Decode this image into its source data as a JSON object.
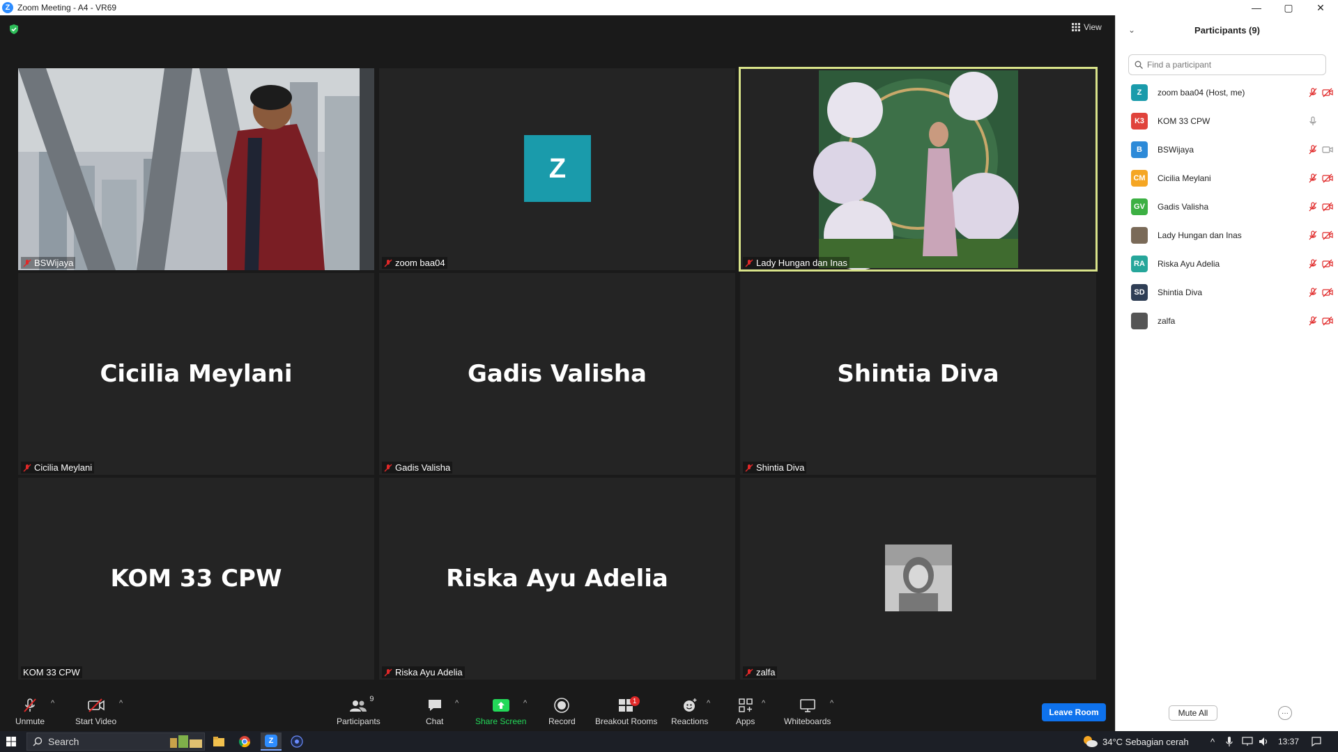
{
  "window": {
    "title": "Zoom Meeting - A4 - VR69",
    "logo_letter": "Z",
    "minimize": "—",
    "restore": "▢",
    "close": "✕"
  },
  "meeting": {
    "view_label": "View",
    "tiles": [
      {
        "name": "BSWijaya",
        "label": "BSWijaya",
        "type": "video-man",
        "muted": true
      },
      {
        "name": "zoom baa04",
        "label": "zoom baa04",
        "type": "avatar",
        "avatar_letter": "Z",
        "avatar_color": "#1a9bab",
        "muted": true
      },
      {
        "name": "Lady Hungan dan Inas",
        "label": "Lady Hungan dan Inas",
        "type": "video-woman",
        "muted": true,
        "active_speaker": true
      },
      {
        "name": "Cicilia Meylani",
        "label": "Cicilia Meylani",
        "type": "name",
        "muted": true
      },
      {
        "name": "Gadis Valisha",
        "label": "Gadis Valisha",
        "type": "name",
        "muted": true
      },
      {
        "name": "Shintia Diva",
        "label": "Shintia Diva",
        "type": "name",
        "muted": true
      },
      {
        "name": "KOM 33 CPW",
        "label": "KOM 33 CPW",
        "type": "name",
        "muted": false
      },
      {
        "name": "Riska Ayu Adelia",
        "label": "Riska Ayu Adelia",
        "type": "name",
        "muted": true
      },
      {
        "name": "zalfa",
        "label": "zalfa",
        "type": "photo",
        "muted": true
      }
    ]
  },
  "toolbar": {
    "unmute": "Unmute",
    "start_video": "Start Video",
    "participants": "Participants",
    "participants_count": "9",
    "chat": "Chat",
    "share_screen": "Share Screen",
    "record": "Record",
    "breakout_rooms": "Breakout Rooms",
    "breakout_badge": "1",
    "reactions": "Reactions",
    "apps": "Apps",
    "whiteboards": "Whiteboards",
    "leave": "Leave Room",
    "caret": "^"
  },
  "panel": {
    "title": "Participants (9)",
    "search_placeholder": "Find a participant",
    "participants": [
      {
        "initials": "Z",
        "name": "zoom baa04 (Host, me)",
        "color": "#1a9bab",
        "mic": "muted",
        "video": "off"
      },
      {
        "initials": "K3",
        "name": "KOM 33 CPW",
        "color": "#e0433b",
        "mic": "on",
        "video": "none"
      },
      {
        "initials": "B",
        "name": "BSWijaya",
        "color": "#2d8ad8",
        "mic": "muted",
        "video": "on"
      },
      {
        "initials": "CM",
        "name": "Cicilia Meylani",
        "color": "#f5a623",
        "mic": "muted",
        "video": "off"
      },
      {
        "initials": "GV",
        "name": "Gadis Valisha",
        "color": "#3cb043",
        "mic": "muted",
        "video": "off"
      },
      {
        "initials": "",
        "name": "Lady Hungan dan Inas",
        "color": "#7a6a58",
        "mic": "muted",
        "video": "off"
      },
      {
        "initials": "RA",
        "name": "Riska Ayu Adelia",
        "color": "#26a69a",
        "mic": "muted",
        "video": "off"
      },
      {
        "initials": "SD",
        "name": "Shintia Diva",
        "color": "#2f3e55",
        "mic": "muted",
        "video": "off"
      },
      {
        "initials": "",
        "name": "zalfa",
        "color": "#555555",
        "mic": "muted",
        "video": "off"
      }
    ],
    "mute_all": "Mute All",
    "more": "···"
  },
  "taskbar": {
    "search": "Search",
    "weather": "34°C  Sebagian cerah",
    "time": "13:37"
  }
}
